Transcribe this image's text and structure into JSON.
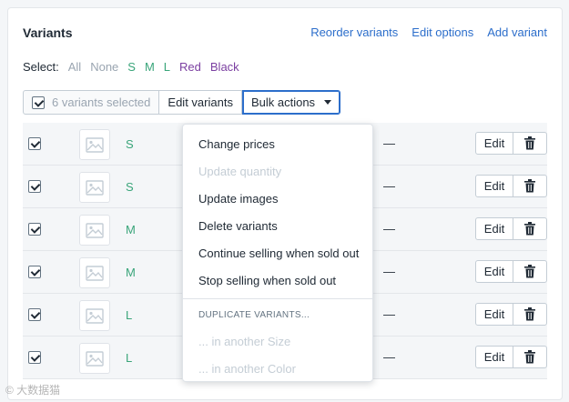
{
  "card": {
    "title": "Variants"
  },
  "header_links": [
    "Reorder variants",
    "Edit options",
    "Add variant"
  ],
  "select": {
    "label": "Select:",
    "options": [
      {
        "text": "All",
        "color": "#9aa5b1"
      },
      {
        "text": "None",
        "color": "#9aa5b1"
      },
      {
        "text": "S",
        "color": "#3aa57a"
      },
      {
        "text": "M",
        "color": "#3aa57a"
      },
      {
        "text": "L",
        "color": "#3aa57a"
      },
      {
        "text": "Red",
        "color": "#7b3fa1"
      },
      {
        "text": "Black",
        "color": "#7b3fa1"
      }
    ]
  },
  "toolbar": {
    "selected_label": "6 variants selected",
    "edit_label": "Edit variants",
    "bulk_label": "Bulk actions"
  },
  "variants": [
    {
      "name": "S",
      "checked": true,
      "dash": "—",
      "edit_label": "Edit"
    },
    {
      "name": "S",
      "checked": true,
      "dash": "—",
      "edit_label": "Edit"
    },
    {
      "name": "M",
      "checked": true,
      "dash": "—",
      "edit_label": "Edit"
    },
    {
      "name": "M",
      "checked": true,
      "dash": "—",
      "edit_label": "Edit"
    },
    {
      "name": "L",
      "checked": true,
      "dash": "—",
      "edit_label": "Edit"
    },
    {
      "name": "L",
      "checked": true,
      "dash": "—",
      "edit_label": "Edit"
    }
  ],
  "bulk_menu": {
    "items": [
      {
        "label": "Change prices",
        "enabled": true
      },
      {
        "label": "Update quantity",
        "enabled": false
      },
      {
        "label": "Update images",
        "enabled": true
      },
      {
        "label": "Delete variants",
        "enabled": true
      },
      {
        "label": "Continue selling when sold out",
        "enabled": true
      },
      {
        "label": "Stop selling when sold out",
        "enabled": true
      }
    ],
    "duplicate_heading": "DUPLICATE VARIANTS...",
    "duplicate_items": [
      {
        "label": "... in another Size",
        "enabled": false
      },
      {
        "label": "... in another Color",
        "enabled": false
      }
    ]
  },
  "watermark": "© 大数据猫"
}
